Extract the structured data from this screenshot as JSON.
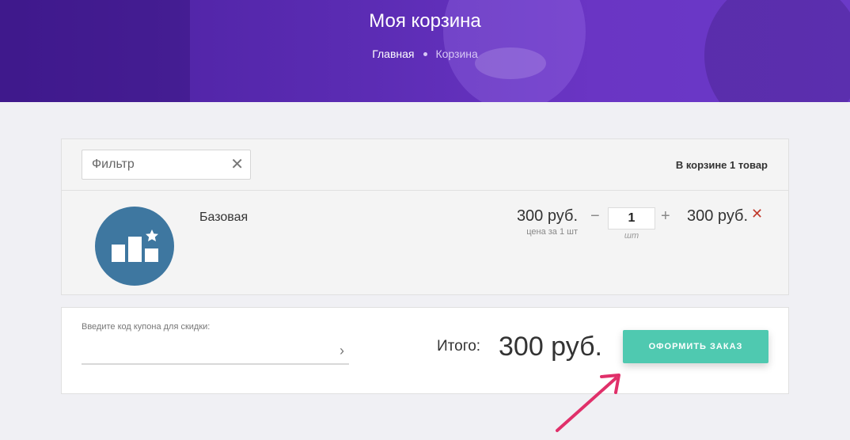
{
  "header": {
    "title": "Моя корзина",
    "breadcrumb": {
      "home": "Главная",
      "current": "Корзина"
    }
  },
  "cart": {
    "filter": {
      "placeholder": "Фильтр",
      "clear_icon": "close-icon"
    },
    "count_text": "В корзине 1 товар",
    "items": [
      {
        "name": "Базовая",
        "icon": "podium-star-icon",
        "price": "300 руб.",
        "price_note": "цена за 1 шт",
        "quantity": "1",
        "quantity_unit": "шт",
        "minus": "−",
        "plus": "+",
        "total": "300 руб.",
        "remove": "✕"
      }
    ]
  },
  "order": {
    "coupon_label": "Введите код купона для скидки:",
    "coupon_arrow": "›",
    "total_label": "Итого:",
    "total_value": "300 руб.",
    "checkout_label": "ОФОРМИТЬ ЗАКАЗ"
  },
  "colors": {
    "header_bg": "#5a2bb2",
    "checkout_bg": "#4fc9b0",
    "product_icon_bg": "#3e77a0",
    "remove": "#c0392b",
    "annotation_arrow": "#e0306a"
  }
}
